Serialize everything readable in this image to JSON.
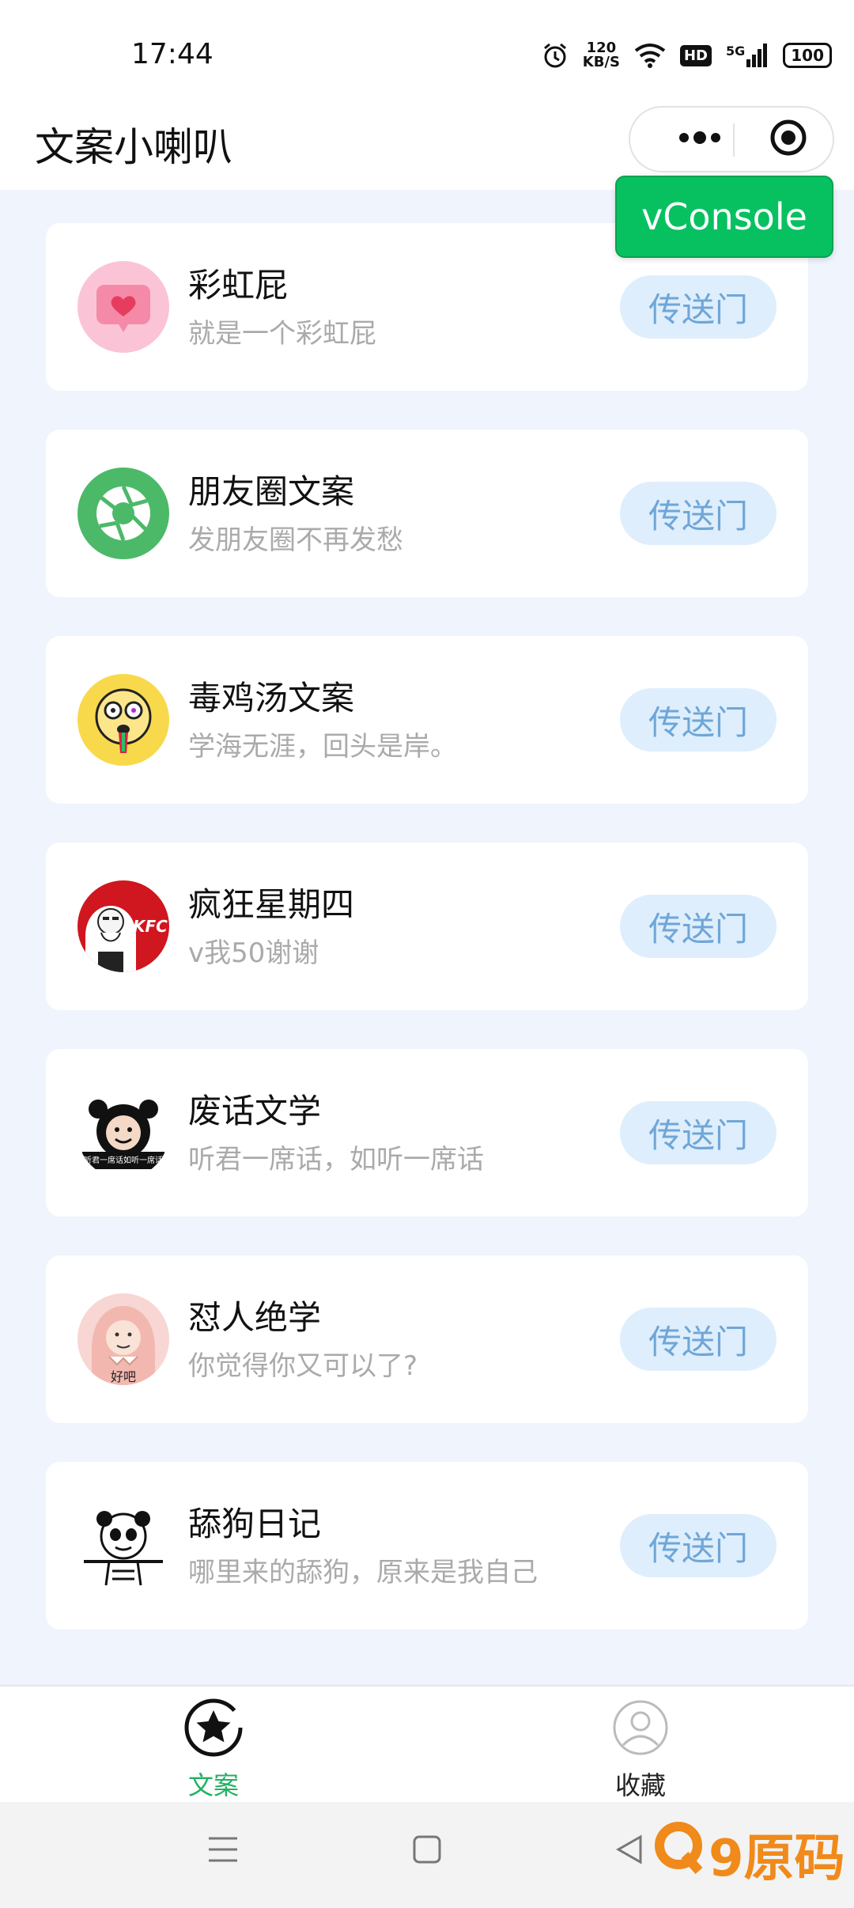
{
  "status_bar": {
    "time": "17:44",
    "net_speed": "120",
    "net_unit": "KB/S",
    "hd": "HD",
    "signal_label": "5G",
    "battery": "100"
  },
  "nav": {
    "title": "文案小喇叭"
  },
  "vconsole": {
    "label": "vConsole",
    "color": "#07c160"
  },
  "cards": [
    {
      "title": "彩虹屁",
      "subtitle": "就是一个彩虹屁",
      "button": "传送门",
      "icon": "heart-message-icon"
    },
    {
      "title": "朋友圈文案",
      "subtitle": "发朋友圈不再发愁",
      "button": "传送门",
      "icon": "camera-aperture-icon"
    },
    {
      "title": "毒鸡汤文案",
      "subtitle": "学海无涯，回头是岸。",
      "button": "传送门",
      "icon": "dizzy-face-icon"
    },
    {
      "title": "疯狂星期四",
      "subtitle": "v我50谢谢",
      "button": "传送门",
      "icon": "kfc-logo-icon"
    },
    {
      "title": "废话文学",
      "subtitle": "听君一席话，如听一席话",
      "button": "传送门",
      "icon": "panda-meme-icon"
    },
    {
      "title": "怼人绝学",
      "subtitle": "你觉得你又可以了?",
      "button": "传送门",
      "icon": "meme-girl-icon"
    },
    {
      "title": "舔狗日记",
      "subtitle": "哪里来的舔狗，原来是我自己",
      "button": "传送门",
      "icon": "panda-sketch-icon"
    }
  ],
  "icon_text": {
    "kfc": "KFC",
    "panda_caption": "听君一席话如听一席话",
    "girl_caption": "好吧"
  },
  "tabs": [
    {
      "label": "文案",
      "icon": "star-icon",
      "active": true
    },
    {
      "label": "收藏",
      "icon": "user-icon",
      "active": false
    }
  ],
  "watermark": {
    "text": "9原码",
    "brand_color": "#f08a1b"
  },
  "colors": {
    "accent_green": "#21b162",
    "button_bg": "#deeefc",
    "button_text": "#6fa6d8",
    "page_bg": "#eff4fd"
  }
}
